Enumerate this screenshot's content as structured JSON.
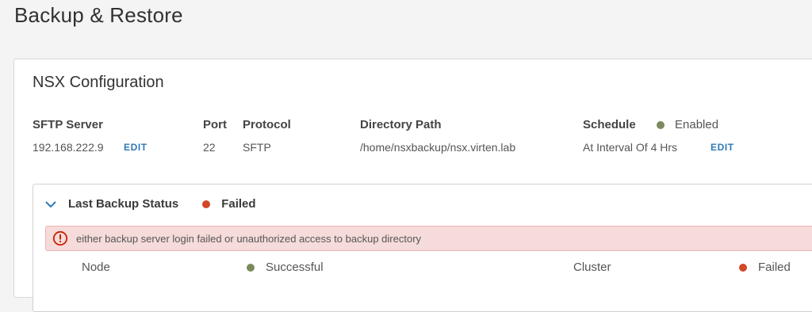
{
  "page": {
    "title": "Backup & Restore"
  },
  "config": {
    "title": "NSX Configuration",
    "columns": {
      "sftp_server": {
        "header": "SFTP Server",
        "value": "192.168.222.9",
        "edit_label": "EDIT"
      },
      "port": {
        "header": "Port",
        "value": "22"
      },
      "protocol": {
        "header": "Protocol",
        "value": "SFTP"
      },
      "directory_path": {
        "header": "Directory Path",
        "value": "/home/nsxbackup/nsx.virten.lab"
      },
      "schedule": {
        "header": "Schedule",
        "status": "Enabled",
        "status_color": "#7a8a5c",
        "value": "At Interval Of 4 Hrs",
        "edit_label": "EDIT"
      }
    }
  },
  "backup_status": {
    "label": "Last Backup Status",
    "status": "Failed",
    "status_color": "#d24725",
    "expanded": true,
    "alert": {
      "icon": "error-circle-icon",
      "message": "either backup server login failed or unauthorized access to backup directory"
    },
    "rows": [
      {
        "label": "Node",
        "status": "Successful",
        "status_color": "#7a8a5c"
      },
      {
        "label": "Cluster",
        "status": "Failed",
        "status_color": "#d24725"
      }
    ]
  },
  "colors": {
    "link": "#2f7ab6",
    "alert_bg": "#f5dbd9",
    "alert_border": "#ebb5b0",
    "success": "#7a8a5c",
    "error": "#d24725"
  }
}
